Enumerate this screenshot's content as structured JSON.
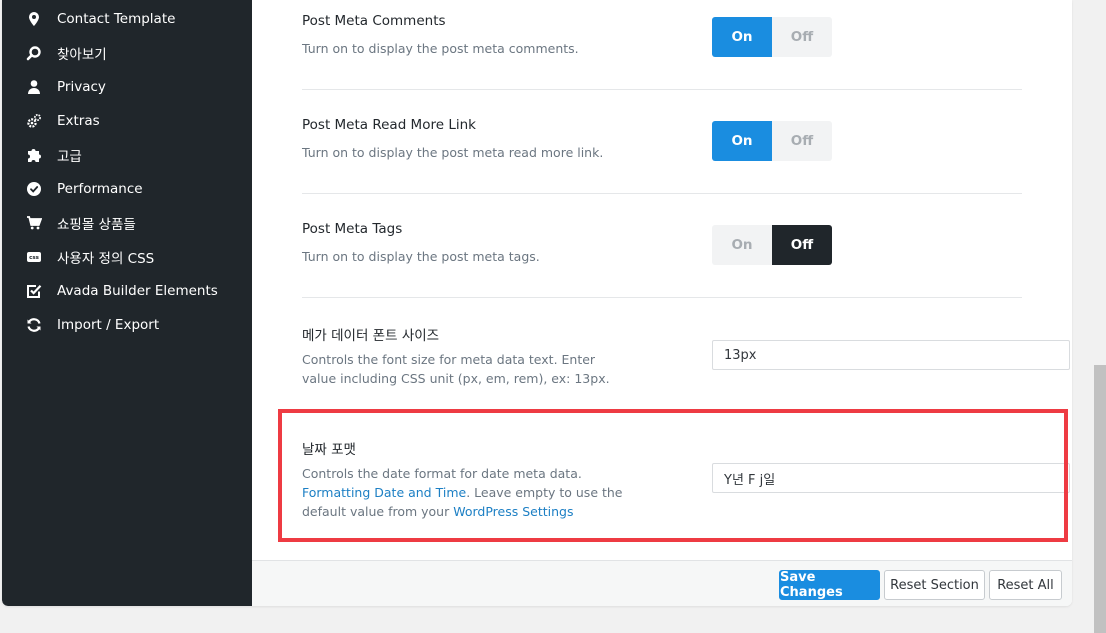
{
  "sidebar": {
    "items": [
      {
        "label": "Contact Template",
        "icon": "map-pin-icon"
      },
      {
        "label": "찾아보기",
        "icon": "search-icon"
      },
      {
        "label": "Privacy",
        "icon": "user-icon"
      },
      {
        "label": "Extras",
        "icon": "cogs-icon"
      },
      {
        "label": "고급",
        "icon": "puzzle-icon"
      },
      {
        "label": "Performance",
        "icon": "gauge-icon"
      },
      {
        "label": "쇼핑몰 상품들",
        "icon": "cart-icon"
      },
      {
        "label": "사용자 정의 CSS",
        "icon": "css-icon"
      },
      {
        "label": "Avada Builder Elements",
        "icon": "checkbox-icon"
      },
      {
        "label": "Import / Export",
        "icon": "refresh-icon"
      }
    ]
  },
  "settings": {
    "comments": {
      "title": "Post Meta Comments",
      "desc": "Turn on to display the post meta comments.",
      "on_label": "On",
      "off_label": "Off",
      "state": "on"
    },
    "read_more": {
      "title": "Post Meta Read More Link",
      "desc": "Turn on to display the post meta read more link.",
      "on_label": "On",
      "off_label": "Off",
      "state": "on"
    },
    "tags": {
      "title": "Post Meta Tags",
      "desc": "Turn on to display the post meta tags.",
      "on_label": "On",
      "off_label": "Off",
      "state": "off"
    },
    "font_size": {
      "title": "메가 데이터 폰트 사이즈",
      "desc": "Controls the font size for meta data text. Enter value including CSS unit (px, em, rem), ex: 13px.",
      "value": "13px"
    },
    "date_format": {
      "title": "날짜 포맷",
      "desc_part1": "Controls the date format for date meta data.",
      "link1": "Formatting Date and Time",
      "desc_part2": ". Leave empty to use the default value from your",
      "link2": "WordPress Settings",
      "value": "Y년 F j일"
    }
  },
  "footer": {
    "save_label": "Save Changes",
    "reset_section_label": "Reset Section",
    "reset_all_label": "Reset All"
  },
  "colors": {
    "sidebar_bg": "#20262b",
    "accent": "#1a8de0",
    "highlight": "#ee3b43"
  }
}
